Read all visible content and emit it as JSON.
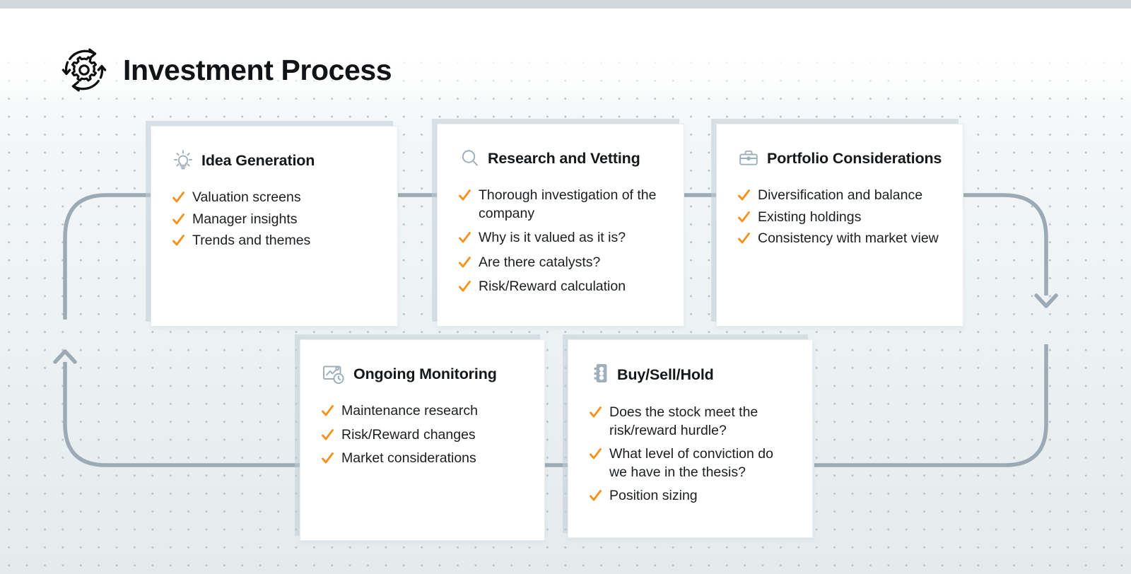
{
  "header": {
    "title": "Investment Process",
    "icon": "circular-arrows-gear-icon"
  },
  "theme": {
    "accent_check": "#F5921E",
    "icon_gray": "#9FB0BC",
    "connector_gray": "#9BAAB4",
    "card_shadow": "#C1CDD5",
    "title_color": "#111316",
    "background_top": "#FFFFFF",
    "background_bottom": "#E5EBED",
    "top_band": "#D2D8DE",
    "dot_color": "#B9C2C9"
  },
  "cards": [
    {
      "id": "idea-generation",
      "icon": "lightbulb-icon",
      "title": "Idea Generation",
      "items": [
        "Valuation screens",
        "Manager insights",
        "Trends and themes"
      ]
    },
    {
      "id": "research-and-vetting",
      "icon": "magnifying-glass-icon",
      "title": "Research and Vetting",
      "items": [
        "Thorough investigation of the company",
        "Why is it valued as it is?",
        "Are there catalysts?",
        "Risk/Reward calculation"
      ]
    },
    {
      "id": "portfolio-considerations",
      "icon": "briefcase-icon",
      "title": "Portfolio Considerations",
      "items": [
        "Diversification and balance",
        "Existing holdings",
        "Consistency with market view"
      ]
    },
    {
      "id": "ongoing-monitoring",
      "icon": "chart-clock-icon",
      "title": "Ongoing Monitoring",
      "items": [
        "Maintenance research",
        "Risk/Reward changes",
        "Market considerations"
      ]
    },
    {
      "id": "buy-sell-hold",
      "icon": "traffic-light-icon",
      "title": "Buy/Sell/Hold",
      "items": [
        "Does the stock meet the risk/reward hurdle?",
        "What level of conviction do we have in the thesis?",
        "Position sizing"
      ]
    }
  ],
  "connectors": [
    {
      "name": "idea-to-research",
      "type": "horizontal-line"
    },
    {
      "name": "research-to-portfolio",
      "type": "horizontal-line"
    },
    {
      "name": "portfolio-to-monitoring",
      "type": "curve-right-down-arrow"
    },
    {
      "name": "monitoring-to-buysell",
      "type": "horizontal-line"
    },
    {
      "name": "buysell-to-idea",
      "type": "curve-left-up-arrow"
    }
  ]
}
